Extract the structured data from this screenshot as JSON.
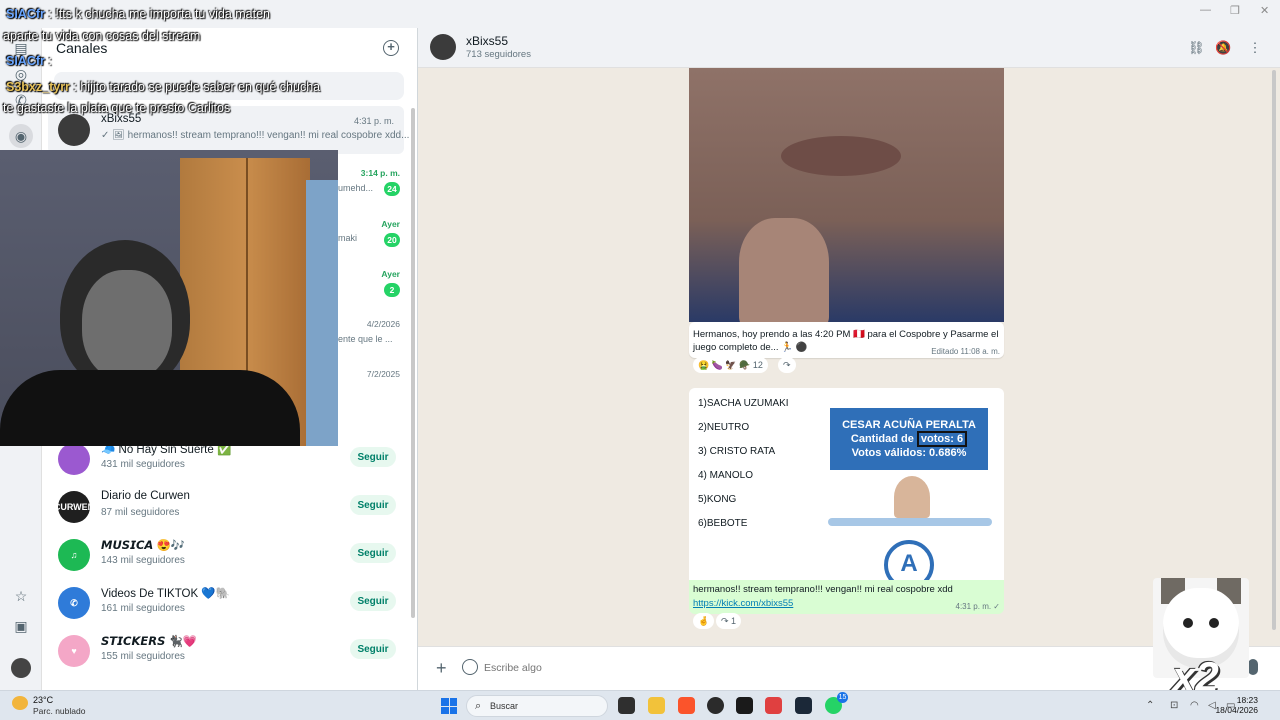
{
  "window": {
    "minimize": "—",
    "maximize": "❐",
    "close": "✕"
  },
  "overlay_chat": [
    {
      "user": "SIACfr",
      "text": " : !tts k chucha me importa tu vida maten"
    },
    {
      "user": "",
      "text": "aparte tu vida con cosas del stream"
    },
    {
      "user": "SIACfr",
      "text": " :"
    },
    {
      "user": "S3bxz_tyrr",
      "text": " : hijito tarado se puede saber en qué chucha"
    },
    {
      "user": "",
      "text": "te gastaste la plata que te presto Carlitos"
    }
  ],
  "sidebar": {
    "title": "Canales",
    "active_channel": {
      "name": "xBixs55",
      "time": "4:31 p. m.",
      "preview": "✓ 🖼 hermanos!! stream temprano!!! vengan!! mi real cospobre xdd..."
    },
    "unread": [
      {
        "time": "3:14 p. m.",
        "badge": "24",
        "snippet": "umehd...",
        "time_green": true
      },
      {
        "time": "Ayer",
        "badge": "20",
        "snippet": "maki",
        "time_green": true
      },
      {
        "time": "Ayer",
        "badge": "2",
        "snippet": "",
        "time_green": true
      },
      {
        "time": "4/2/2026",
        "badge": "",
        "snippet": "ente que le ...",
        "time_green": false
      },
      {
        "time": "7/2/2025",
        "badge": "",
        "snippet": "",
        "time_green": false
      }
    ],
    "suggested": [
      {
        "name": "🧢 No Hay Sin Suerte ✅",
        "followers": "431 mil seguidores",
        "follow": "Seguir",
        "color": "#9b59d0",
        "initials": ""
      },
      {
        "name": "Diario de Curwen",
        "followers": "87 mil seguidores",
        "follow": "Seguir",
        "color": "#1f1f1f",
        "initials": "CURWEN"
      },
      {
        "name": "𝙈𝙐𝙎𝙄𝘾𝘼 😍🎶",
        "followers": "143 mil seguidores",
        "follow": "Seguir",
        "color": "#1db954",
        "initials": "♫"
      },
      {
        "name": "Videos De TIKTOK 💙🐘",
        "followers": "161 mil seguidores",
        "follow": "Seguir",
        "color": "#2f7bd9",
        "initials": "✆"
      },
      {
        "name": "𝙎𝙏𝙄𝘾𝙆𝙀𝙍𝙎 🐈‍⬛💗",
        "followers": "155 mil seguidores",
        "follow": "Seguir",
        "color": "#f4a7c7",
        "initials": "♥"
      }
    ]
  },
  "conversation": {
    "name": "xBixs55",
    "followers": "713 seguidores",
    "message1": {
      "text": "Hermanos, hoy prendo a las 4:20 PM 🇵🇪 para el Cospobre y Pasarme el juego completo de... 🏃 ⚫",
      "edited": "Editado 11:08 a. m.",
      "reactions": "🤮 🍆 🦅 🪖 12",
      "share": "↷"
    },
    "message2": {
      "list": [
        "1)SACHA UZUMAKI",
        "2)NEUTRO",
        "3) CRISTO RATA",
        "4) MANOLO",
        "5)KONG",
        "6)BEBOTE"
      ],
      "vote_title": "CESAR ACUÑA PERALTA",
      "vote_count_label": "Cantidad de ",
      "vote_count_value": "votos: 6",
      "vote_valid": "Votos válidos: 0.686%",
      "logo_letter": "A",
      "text": "hermanos!! stream temprano!!! vengan!! mi real cospobre xdd",
      "link": "https://kick.com/xbixs55",
      "time": "4:31 p. m. ✓",
      "reactions": "🤞",
      "share": "↷ 1"
    },
    "composer_placeholder": "Escribe algo"
  },
  "cat_overlay": {
    "multiplier": "x2"
  },
  "taskbar": {
    "weather_temp": "23°C",
    "weather_desc": "Parc. nublado",
    "search": "Buscar",
    "whatsapp_badge": "15",
    "time": "18:23",
    "date": "18/04/2026"
  }
}
